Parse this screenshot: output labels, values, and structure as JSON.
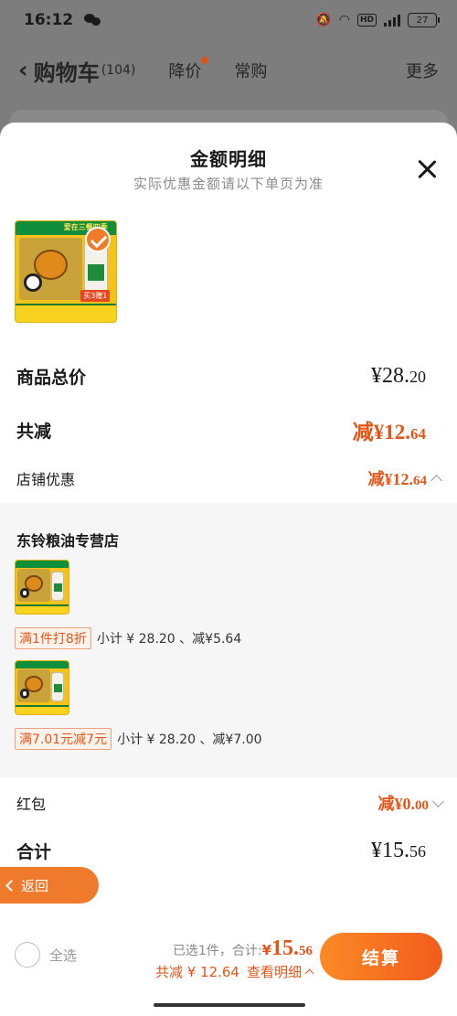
{
  "status_bar": {
    "time": "16:12",
    "hd": "HD",
    "network": "4G",
    "battery": "27"
  },
  "cart_header": {
    "title": "购物车",
    "count": "(104)",
    "tab_price_drop": "降价",
    "tab_frequent": "常购",
    "more": "更多"
  },
  "sheet": {
    "title": "金额明细",
    "subtitle": "实际优惠金额请以下单页为准",
    "product_thumbnail": {
      "banner_text": "爱在三餐四季",
      "badge": "买3赠1"
    },
    "rows": {
      "total_price_label": "商品总价",
      "total_price_main": "¥28.",
      "total_price_decimal": "20",
      "discount_label": "共减",
      "discount_main": "减¥12.",
      "discount_decimal": "64",
      "shop_discount_label": "店铺优惠",
      "shop_discount_main": "减¥12.",
      "shop_discount_decimal": "64",
      "red_packet_label": "红包",
      "red_packet_main": "减¥0.",
      "red_packet_decimal": "00",
      "sum_label": "合计",
      "sum_main": "¥15.",
      "sum_decimal": "56"
    },
    "shop": {
      "name": "东铃粮油专营店",
      "items": [
        {
          "tag": "满1件打8折",
          "subtotal": "小计 ¥ 28.20 、减¥5.64"
        },
        {
          "tag": "满7.01元减7元",
          "subtotal": "小计 ¥ 28.20 、减¥7.00"
        }
      ]
    }
  },
  "return_button": {
    "label": "返回"
  },
  "bottom_bar": {
    "select_all": "全选",
    "selected_text": "已选1件，合计:",
    "total_yen": "¥",
    "total_main": "15.",
    "total_decimal": "56",
    "discount_text": "共减 ¥ 12.64",
    "view_detail": "查看明细",
    "checkout": "结算"
  },
  "colors": {
    "accent_orange": "#e2561a",
    "checkout_gradient_start": "#fb8a26",
    "checkout_gradient_end": "#f25c1c"
  },
  "icons": [
    "wechat-icon",
    "mute-icon",
    "wifi-icon",
    "signal-icon",
    "battery-icon",
    "back-chevron-icon",
    "close-icon",
    "checkmark-icon",
    "caret-up-icon",
    "caret-down-icon"
  ]
}
